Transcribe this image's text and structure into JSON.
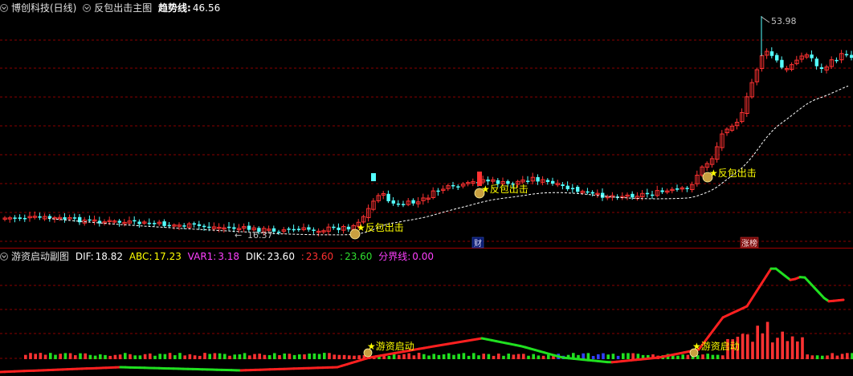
{
  "main_pane": {
    "stock_name": "博创科技(日线)",
    "indicator_name": "反包出击主图",
    "trend_label": "趋势线:",
    "trend_value": "46.56",
    "high_label": "53.98",
    "low_label": "16.37",
    "signal_label": "★反包出击",
    "event_badge_1": "财",
    "event_badge_2": "涨榜"
  },
  "sub_pane": {
    "indicator_name": "游资启动副图",
    "dif_label": "DIF:",
    "dif_value": "18.82",
    "abc_label": "ABC:",
    "abc_value": "17.23",
    "var1_label": "VAR1:",
    "var1_value": "3.18",
    "dik_label": "DIK:",
    "dik_value": "23.60",
    "red_sep": ":",
    "red_value": "23.60",
    "green_sep": ":",
    "green_value": "23.60",
    "boundary_label": "分界线:",
    "boundary_value": "0.00",
    "signal_label": "★游资启动"
  },
  "colors": {
    "up": "#ff3232",
    "down": "#54ffff",
    "grid": "#8a0000",
    "trend": "#ffffff",
    "signal": "#ffff00",
    "dif_up": "#ff2020",
    "dif_down": "#20e020",
    "var1": "#ff40ff"
  }
}
